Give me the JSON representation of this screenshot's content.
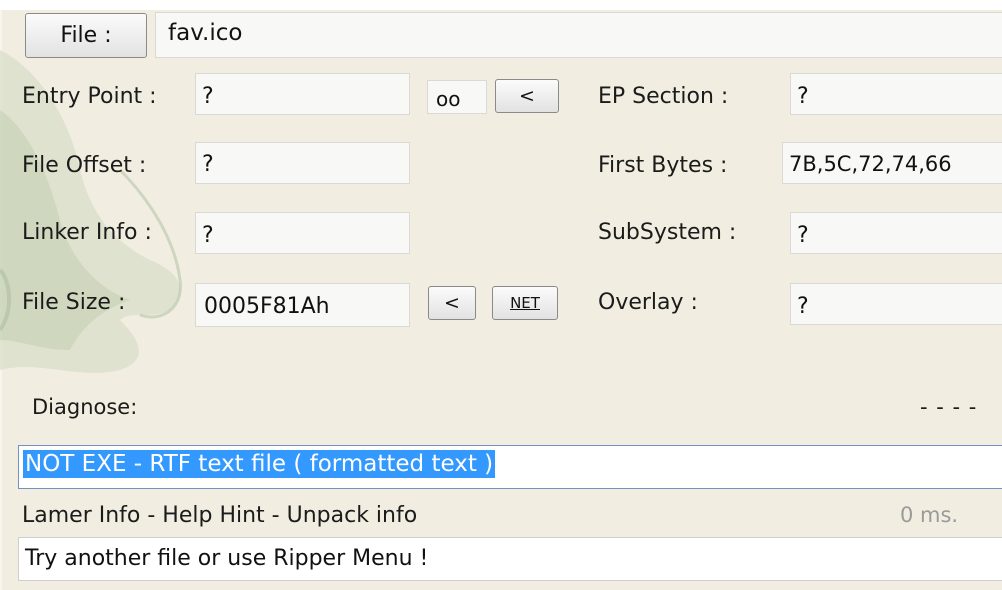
{
  "file_button": {
    "label": "File :"
  },
  "file_path": "fav.ico",
  "fields": {
    "entry_point": {
      "label": "Entry Point :",
      "value": "?"
    },
    "file_offset": {
      "label": "File Offset :",
      "value": "?"
    },
    "linker_info": {
      "label": "Linker Info :",
      "value": "?"
    },
    "file_size": {
      "label": "File Size :",
      "value": "0005F81Ah"
    },
    "ep_section": {
      "label": "EP Section :",
      "value": "?"
    },
    "first_bytes": {
      "label": "First Bytes :",
      "value": "7B,5C,72,74,66"
    },
    "subsystem": {
      "label": "SubSystem :",
      "value": "?"
    },
    "overlay": {
      "label": "Overlay :",
      "value": "?"
    }
  },
  "buttons": {
    "oo": "oo",
    "entry_back": "<",
    "size_back": "<",
    "net": "NET"
  },
  "diagnose": {
    "label": "Diagnose:",
    "dashes": "- - - -"
  },
  "result": "NOT EXE - RTF text file ( formatted text )",
  "lamer_info": {
    "label": "Lamer Info - Help Hint - Unpack info",
    "time": "0 ms."
  },
  "hint": "Try another file or use Ripper Menu !",
  "colors": {
    "background": "#f1eee1",
    "selection": "#3399ff",
    "result_text": "#ffffff"
  }
}
